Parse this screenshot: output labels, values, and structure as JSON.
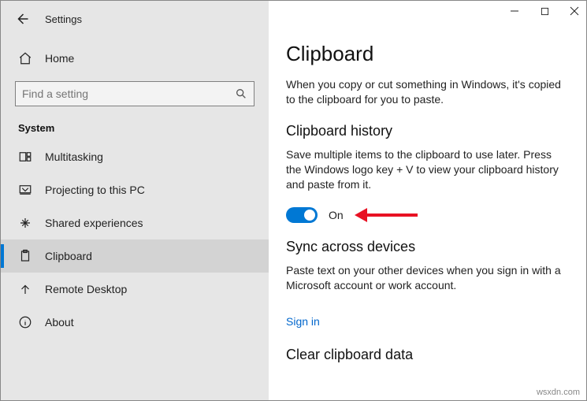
{
  "header": {
    "app_title": "Settings"
  },
  "sidebar": {
    "home_label": "Home",
    "search_placeholder": "Find a setting",
    "group_title": "System",
    "items": [
      {
        "label": "Multitasking"
      },
      {
        "label": "Projecting to this PC"
      },
      {
        "label": "Shared experiences"
      },
      {
        "label": "Clipboard"
      },
      {
        "label": "Remote Desktop"
      },
      {
        "label": "About"
      }
    ]
  },
  "main": {
    "title": "Clipboard",
    "intro": "When you copy or cut something in Windows, it's copied to the clipboard for you to paste.",
    "history_heading": "Clipboard history",
    "history_desc": "Save multiple items to the clipboard to use later. Press the Windows logo key + V to view your clipboard history and paste from it.",
    "toggle_state_label": "On",
    "sync_heading": "Sync across devices",
    "sync_desc": "Paste text on your other devices when you sign in with a Microsoft account or work account.",
    "signin_link": "Sign in",
    "clear_heading": "Clear clipboard data"
  },
  "watermark": "wsxdn.com"
}
